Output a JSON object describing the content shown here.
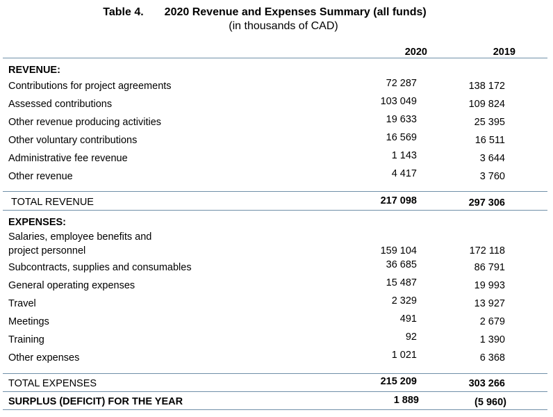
{
  "table": {
    "number": "Table 4.",
    "title": "2020 Revenue and Expenses Summary (all funds)",
    "subtitle": "(in thousands of CAD)",
    "col_2020": "2020",
    "col_2019": "2019"
  },
  "revenue": {
    "heading": "REVENUE:",
    "rows": [
      {
        "label": "Contributions for project agreements",
        "v2020": "72 287",
        "v2019": "138 172"
      },
      {
        "label": "Assessed contributions",
        "v2020": "103 049",
        "v2019": "109 824"
      },
      {
        "label": "Other revenue producing activities",
        "v2020": "19 633",
        "v2019": "25 395"
      },
      {
        "label": "Other voluntary contributions",
        "v2020": "16 569",
        "v2019": "16 511"
      },
      {
        "label": "Administrative fee revenue",
        "v2020": "1 143",
        "v2019": "3 644"
      },
      {
        "label": "Other revenue",
        "v2020": "4 417",
        "v2019": "3 760"
      }
    ],
    "total": {
      "label": "TOTAL REVENUE",
      "v2020": "217 098",
      "v2019": "297 306"
    }
  },
  "expenses": {
    "heading": "EXPENSES:",
    "rows": [
      {
        "label_line1": "Salaries, employee benefits and",
        "label": "project personnel",
        "v2020": "159 104",
        "v2019": "172 118"
      },
      {
        "label": "Subcontracts, supplies and consumables",
        "v2020": "36 685",
        "v2019": "86 791"
      },
      {
        "label": "General operating expenses",
        "v2020": "15 487",
        "v2019": "19 993"
      },
      {
        "label": "Travel",
        "v2020": "2 329",
        "v2019": "13 927"
      },
      {
        "label": "Meetings",
        "v2020": "491",
        "v2019": "2 679"
      },
      {
        "label": "Training",
        "v2020": "92",
        "v2019": "1 390"
      },
      {
        "label": "Other expenses",
        "v2020": "1 021",
        "v2019": "6 368"
      }
    ],
    "total": {
      "label": "TOTAL EXPENSES",
      "v2020": "215 209",
      "v2019": "303 266"
    }
  },
  "surplus": {
    "label": "SURPLUS (DEFICIT) FOR THE YEAR",
    "v2020": "1 889",
    "v2019": "(5 960)"
  }
}
